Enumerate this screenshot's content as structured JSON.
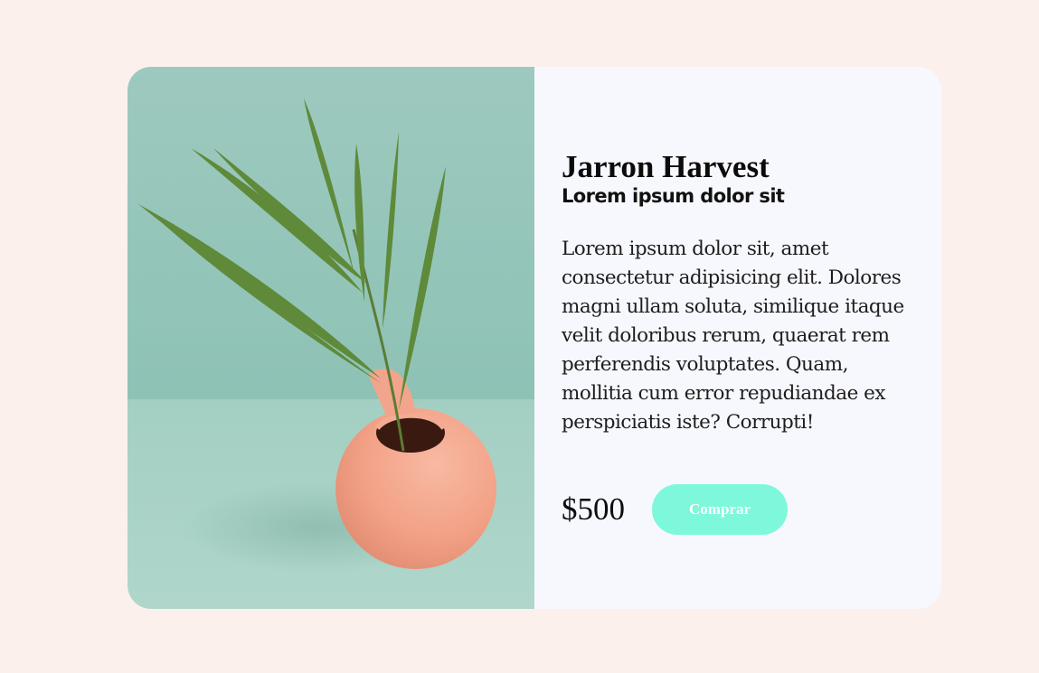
{
  "product": {
    "title": "Jarron Harvest",
    "subtitle": "Lorem ipsum dolor sit",
    "description": "Lorem ipsum dolor sit, amet consectetur adipisicing elit. Dolores magni ullam soluta, similique itaque velit doloribus rerum, quaerat rem perferendis voluptates. Quam, mollitia cum error repudiandae ex perspiciatis iste? Corrupti!",
    "price": "$500",
    "buy_label": "Comprar"
  },
  "colors": {
    "page_background": "#fcf0ec",
    "card_background": "#f7f8fd",
    "button_accent": "#7df8da",
    "photo_wall": "#9ccabf",
    "photo_table": "#a7d2c5",
    "vase": "#f3a48c"
  }
}
